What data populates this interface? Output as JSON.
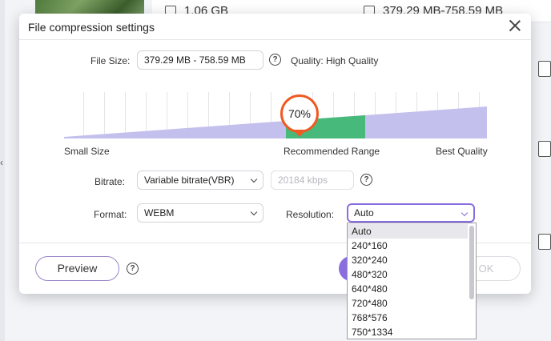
{
  "background": {
    "row_sizes": [
      "1.06 GB",
      "379.29 MB-758.59 MB"
    ]
  },
  "dialog": {
    "title": "File compression settings",
    "file_size_label": "File Size:",
    "file_size_value": "379.29 MB - 758.59 MB",
    "quality_text": "Quality: High Quality",
    "slider": {
      "percent_label": "70%",
      "value": 0.7,
      "left_label": "Small Size",
      "middle_label": "Recommended Range",
      "right_label": "Best Quality"
    },
    "bitrate_label": "Bitrate:",
    "bitrate_value": "Variable bitrate(VBR)",
    "bitrate_kbps": "20184 kbps",
    "format_label": "Format:",
    "format_value": "WEBM",
    "resolution_label": "Resolution:",
    "resolution_value": "Auto",
    "preview_label": "Preview",
    "ok_label": "OK",
    "resolution_options": [
      "Auto",
      "240*160",
      "320*240",
      "480*320",
      "640*480",
      "720*480",
      "768*576",
      "750*1334"
    ]
  },
  "colors": {
    "accent": "#8a6ee0",
    "slider_fill": "#c4c0ee",
    "recommended": "#47b97a",
    "knob": "#f05a22"
  },
  "icons": [
    "folder-icon",
    "help-icon",
    "close-icon",
    "chevron-down-icon",
    "file-icon"
  ]
}
